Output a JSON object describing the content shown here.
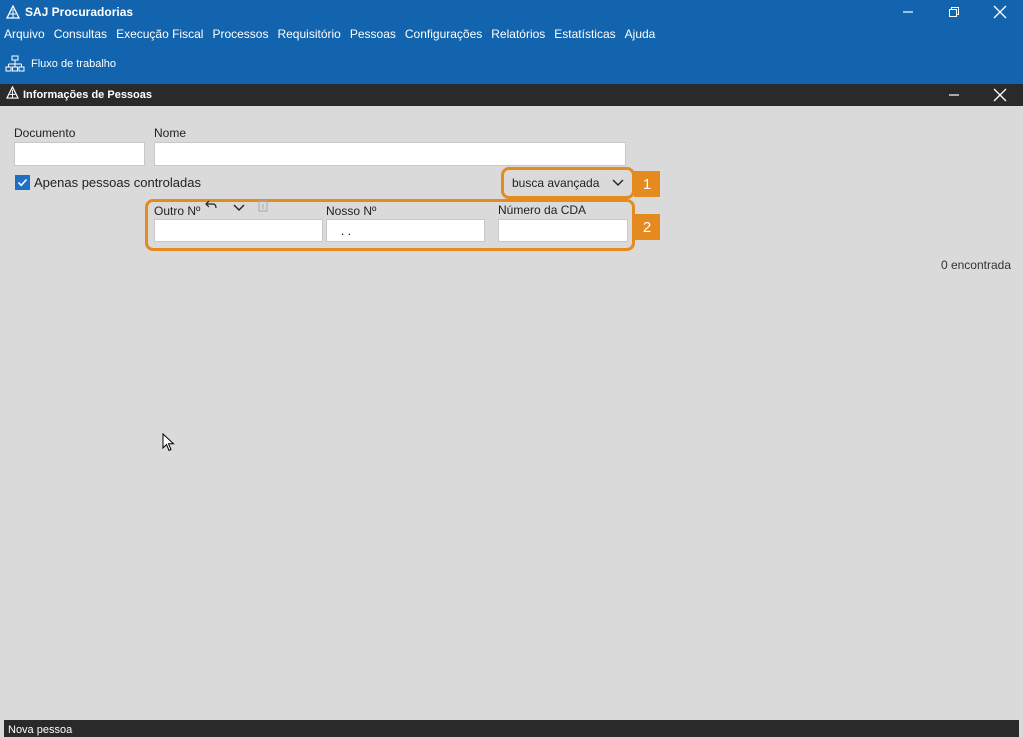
{
  "window": {
    "title": "SAJ Procuradorias",
    "icons": [
      "app-logo-icon",
      "minimize-icon",
      "restore-icon",
      "close-icon"
    ]
  },
  "menu": {
    "items": [
      "Arquivo",
      "Consultas",
      "Execução Fiscal",
      "Processos",
      "Requisitório",
      "Pessoas",
      "Configurações",
      "Relatórios",
      "Estatísticas",
      "Ajuda"
    ]
  },
  "toolbar": {
    "workflow_label": "Fluxo de trabalho",
    "workflow_icon": "org-chart-icon"
  },
  "panel": {
    "title": "Informações de Pessoas"
  },
  "form": {
    "documento_label": "Documento",
    "documento_value": "",
    "nome_label": "Nome",
    "nome_value": "",
    "controladas_label": "Apenas pessoas controladas",
    "controladas_checked": true,
    "busca_label": "busca avançada",
    "outro_label": "Outro Nº",
    "outro_value": "",
    "nosso_label": "Nosso Nº",
    "nosso_value": ". .",
    "cda_label": "Número da CDA",
    "cda_value": ""
  },
  "annotations": {
    "badge1": "1",
    "badge2": "2",
    "accent_color": "#e58a1f"
  },
  "results": {
    "count_text": "0 encontrada"
  },
  "status": {
    "new_person": "Nova pessoa"
  },
  "colors": {
    "titlebar": "#1164ad",
    "innerbar": "#2a2a2a",
    "background": "#dadada"
  }
}
